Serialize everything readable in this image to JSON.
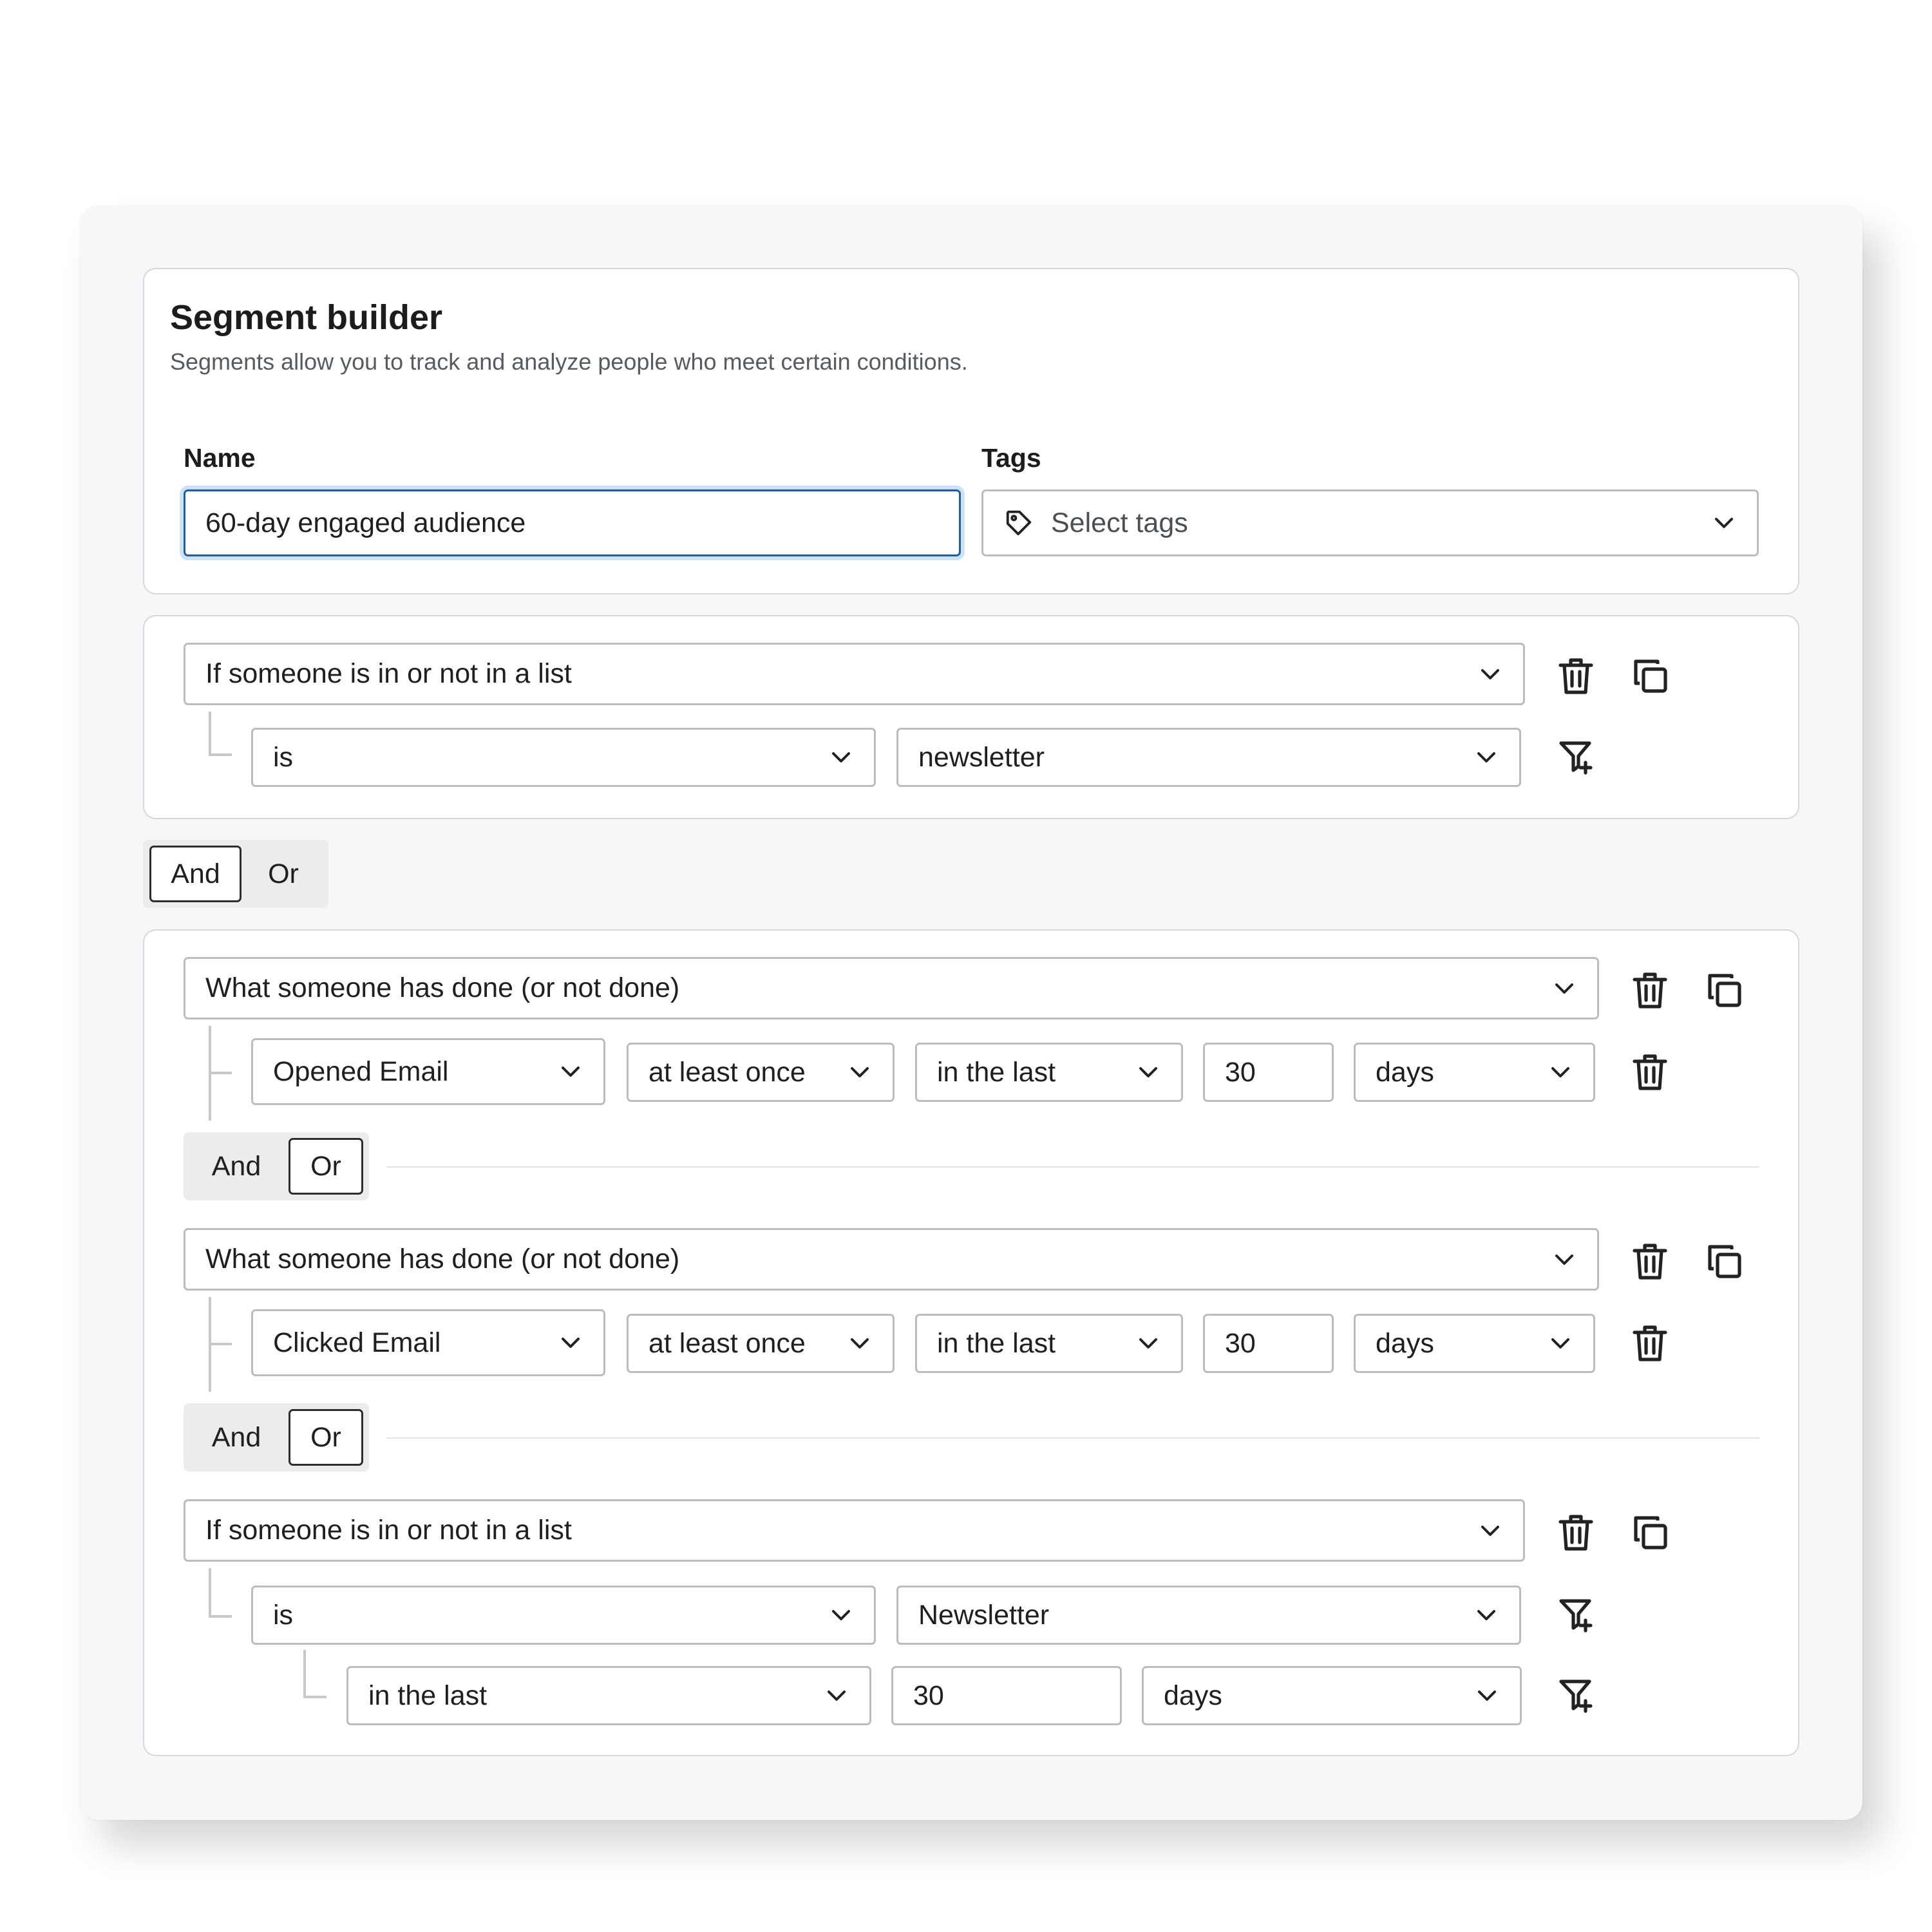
{
  "header": {
    "title": "Segment builder",
    "subtitle": "Segments allow you to track and analyze people who meet certain conditions."
  },
  "form": {
    "name_label": "Name",
    "name_value": "60-day engaged audience",
    "tags_label": "Tags",
    "tags_placeholder": "Select tags"
  },
  "group1": {
    "condition": "If someone is in or not in a list",
    "operator": "is",
    "list": "newsletter"
  },
  "group_join": {
    "and": "And",
    "or": "Or",
    "active": "And"
  },
  "group2": {
    "condition1": {
      "type": "What someone has done (or not done)",
      "metric": "Opened Email",
      "frequency": "at least once",
      "timeframe": "in the last",
      "amount": "30",
      "unit": "days"
    },
    "join1": {
      "and": "And",
      "or": "Or",
      "active": "Or"
    },
    "condition2": {
      "type": "What someone has done (or not done)",
      "metric": "Clicked Email",
      "frequency": "at least once",
      "timeframe": "in the last",
      "amount": "30",
      "unit": "days"
    },
    "join2": {
      "and": "And",
      "or": "Or",
      "active": "Or"
    },
    "condition3": {
      "type": "If someone is in or not in a list",
      "operator": "is",
      "list": "Newsletter",
      "timeframe": "in the last",
      "amount": "30",
      "unit": "days"
    }
  },
  "icons": {
    "delete": "trash-icon",
    "duplicate": "copy-icon",
    "add_filter": "filter-plus-icon",
    "tag": "tag-icon",
    "dropdown": "chevron-down-icon"
  },
  "colors": {
    "focus_border": "#1c5fa8",
    "focus_ring": "#cde2f5",
    "field_border": "#b9bcc1",
    "toggle_bg": "#ececed"
  }
}
